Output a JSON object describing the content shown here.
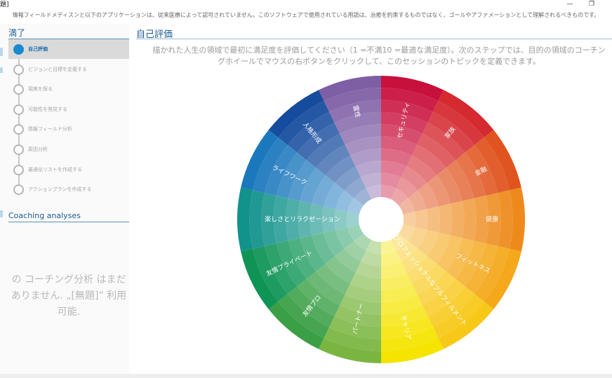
{
  "window": {
    "title": "題]",
    "minimize_glyph": "—",
    "restore_glyph": "❐"
  },
  "disclaimer": "情報フィールドメディスンと以下のアプリケーションは、従来医療によって認可されていません。このソフトウェアで使用されている用語は、治癒を約束するものではなく、ゴールやアファメーションとして理解されるべきものです。",
  "sidebar": {
    "section_title": "満了",
    "steps": [
      {
        "label": "自己評価",
        "active": true
      },
      {
        "label": "ビジョンと目標を定義する",
        "active": false
      },
      {
        "label": "現実を探る",
        "active": false
      },
      {
        "label": "可能性を発見する",
        "active": false
      },
      {
        "label": "情報フィールド分析",
        "active": false
      },
      {
        "label": "原因分析",
        "active": false
      },
      {
        "label": "最適化リストを作成する",
        "active": false
      },
      {
        "label": "アクションプランを作成する",
        "active": false
      }
    ],
    "analyses_title": "Coaching analyses",
    "empty_message": "の コーチング分析 はまだありません. „[無題]” 利用可能."
  },
  "main": {
    "title": "自己評価",
    "instruction_line1": "描かれた人生の領域で最初に満足度を評価してください（1 =不満10 =最適な満足度）。次のステップでは、目的の領域のコーチン",
    "instruction_line2": "グホイールでマウスの右ボタンをクリックして、このセッションのトピックを定義できます。"
  },
  "wheel": {
    "segments": [
      {
        "label": "セキュリティ",
        "color": "#c8103c"
      },
      {
        "label": "家族",
        "color": "#d42a30"
      },
      {
        "label": "金融",
        "color": "#e0541f"
      },
      {
        "label": "健康",
        "color": "#ee8a1c"
      },
      {
        "label": "フィットネス",
        "color": "#f4a81a"
      },
      {
        "label": "プロフェッショナルなフルフィルメント",
        "color": "#f8c818"
      },
      {
        "label": "キャリア",
        "color": "#f5e400"
      },
      {
        "label": "パートナー",
        "color": "#7ab541"
      },
      {
        "label": "友情プロ",
        "color": "#3a9f45"
      },
      {
        "label": "友情プライベート",
        "color": "#0f9455"
      },
      {
        "label": "楽しさとリラクゼーション",
        "color": "#11928a"
      },
      {
        "label": "ライフワーク",
        "color": "#1c78bd"
      },
      {
        "label": "人格形成",
        "color": "#164c9e"
      },
      {
        "label": "霊性",
        "color": "#7e5ea5"
      }
    ]
  }
}
